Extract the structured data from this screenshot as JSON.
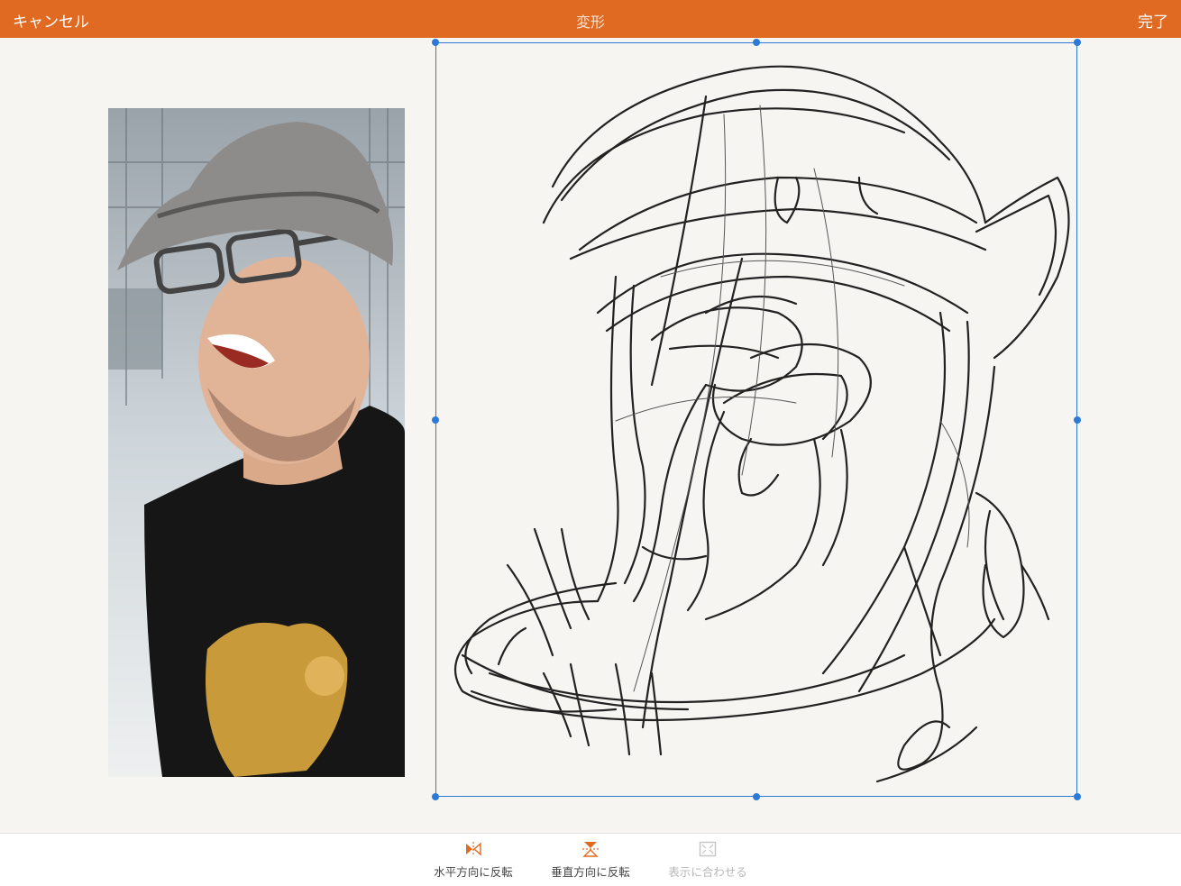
{
  "topbar": {
    "cancel_label": "キャンセル",
    "title": "変形",
    "done_label": "完了"
  },
  "toolbar": {
    "flip_horizontal": {
      "label": "水平方向に反転",
      "icon": "flip-horizontal-icon"
    },
    "flip_vertical": {
      "label": "垂直方向に反転",
      "icon": "flip-vertical-icon"
    },
    "fit_to_view": {
      "label": "表示に合わせる",
      "icon": "fit-to-view-icon",
      "enabled": false
    }
  },
  "colors": {
    "accent": "#e06a22",
    "selection": "#2d7ad6",
    "canvas": "#f6f5f2"
  }
}
